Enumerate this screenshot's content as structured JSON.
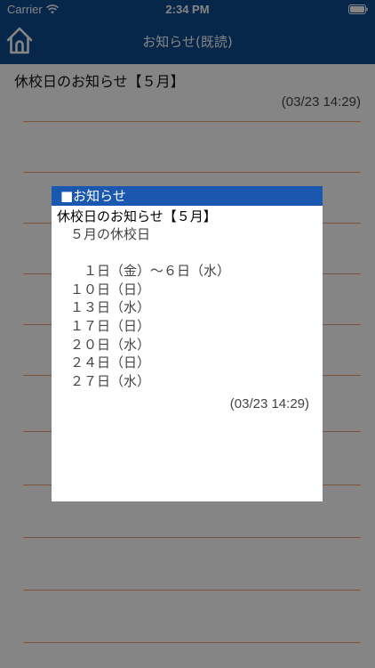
{
  "status_bar": {
    "carrier": "Carrier",
    "time": "2:34 PM"
  },
  "nav": {
    "title": "お知らせ(既読)",
    "home_icon": "home-icon"
  },
  "list": {
    "items": [
      {
        "title": "休校日のお知らせ【５月】",
        "date": "(03/23 14:29)"
      }
    ]
  },
  "dialog": {
    "header": "■お知らせ",
    "title": "休校日のお知らせ【５月】",
    "lines": [
      "　５月の休校日",
      "",
      "　　１日（金）～６日（水）",
      "　１０日（日）",
      "　１３日（水）",
      "　１７日（日）",
      "　２０日（水）",
      "　２４日（日）",
      "　２７日（水）"
    ],
    "date": "(03/23 14:29)"
  },
  "colors": {
    "header_blue": "#0d4a8f",
    "dialog_header_blue": "#1a58b0",
    "rule_orange": "#e6a072"
  }
}
